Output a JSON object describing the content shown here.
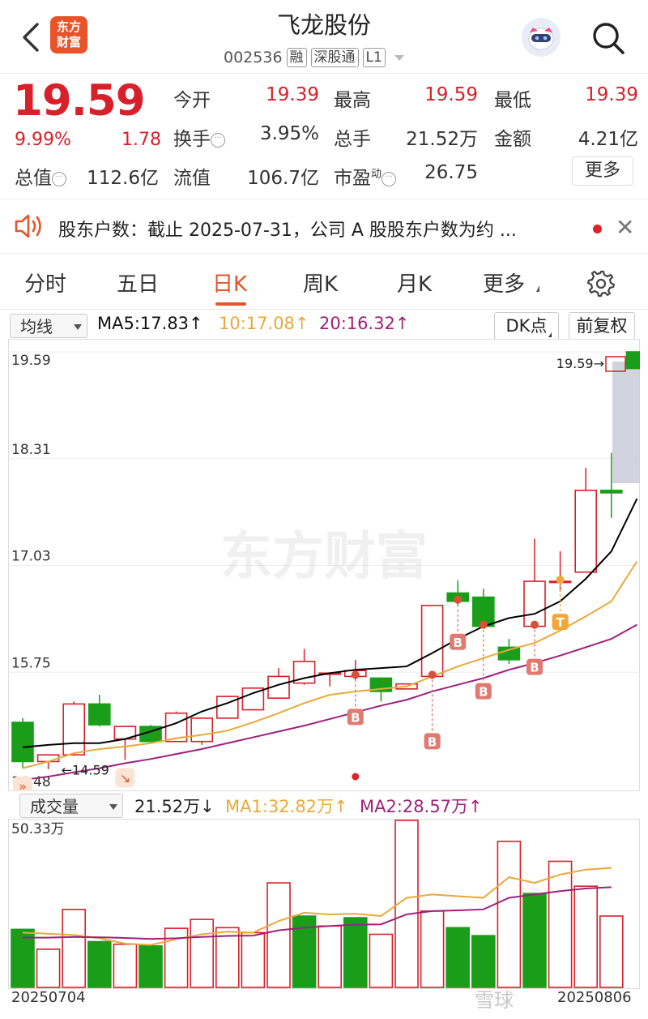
{
  "header": {
    "logo_text_line1": "东方",
    "logo_text_line2": "财富",
    "title": "飞龙股份",
    "code": "002536",
    "tags": [
      "融",
      "深股通",
      "L1"
    ]
  },
  "quote": {
    "price": "19.59",
    "change_pct": "9.99%",
    "change": "1.78",
    "fields": {
      "open_label": "今开",
      "open_value": "19.39",
      "high_label": "最高",
      "high_value": "19.59",
      "low_label": "最低",
      "low_value": "19.39",
      "turnover_label": "换手",
      "turnover_value": "3.95%",
      "volume_label": "总手",
      "volume_value": "21.52万",
      "amount_label": "金额",
      "amount_value": "4.21亿",
      "mktcap_label": "总值",
      "mktcap_value": "112.6亿",
      "float_label": "流值",
      "float_value": "106.7亿",
      "pe_label": "市盈",
      "pe_sup": "动",
      "pe_value": "26.75"
    },
    "more_label": "更多"
  },
  "notice": {
    "text": "股东户数：截止 2025-07-31，公司 A 股股东户数为约 ..."
  },
  "tabs": [
    "分时",
    "五日",
    "日K",
    "周K",
    "月K",
    "更多"
  ],
  "active_tab": "日K",
  "ma_bar": {
    "select_label": "均线",
    "ma5": "MA5:17.83↑",
    "ma10": "10:17.08↑",
    "ma20": "20:16.32↑",
    "dk_label": "DK点",
    "adjust_label": "前复权"
  },
  "kline": {
    "y_labels": [
      "19.59",
      "18.31",
      "17.03",
      "15.75",
      "14.48"
    ],
    "high_marker": "19.59→",
    "low_marker": "←14.59",
    "watermark": "东方财富"
  },
  "volume_bar": {
    "select_label": "成交量",
    "value": "21.52万↓",
    "ma1": "MA1:32.82万↑",
    "ma2": "MA2:28.57万↑",
    "y_max_label": "50.33万"
  },
  "footer": {
    "date_start": "20250704",
    "date_end": "20250806",
    "watermark": "雪球"
  },
  "colors": {
    "up": "#d8202a",
    "down": "#1a9e1a",
    "ma5": "#000000",
    "ma10": "#e8a93a",
    "ma20": "#a0207a",
    "accent": "#e8532a"
  },
  "chart_data": {
    "type": "candlestick",
    "y_range": [
      14.48,
      19.59
    ],
    "candles": [
      {
        "o": 15.15,
        "h": 15.2,
        "c": 14.68,
        "l": 14.6
      },
      {
        "o": 14.68,
        "h": 14.76,
        "c": 14.76,
        "l": 14.59
      },
      {
        "o": 14.76,
        "h": 15.4,
        "c": 15.37,
        "l": 14.76
      },
      {
        "o": 15.37,
        "h": 15.48,
        "c": 15.12,
        "l": 15.1
      },
      {
        "o": 14.95,
        "h": 15.1,
        "c": 15.1,
        "l": 14.7
      },
      {
        "o": 15.1,
        "h": 15.12,
        "c": 14.92,
        "l": 14.92
      },
      {
        "o": 14.92,
        "h": 15.28,
        "c": 15.26,
        "l": 14.92
      },
      {
        "o": 14.92,
        "h": 15.2,
        "c": 15.2,
        "l": 14.88
      },
      {
        "o": 15.2,
        "h": 15.47,
        "c": 15.46,
        "l": 15.2
      },
      {
        "o": 15.3,
        "h": 15.57,
        "c": 15.56,
        "l": 15.3
      },
      {
        "o": 15.44,
        "h": 15.8,
        "c": 15.7,
        "l": 15.44
      },
      {
        "o": 15.62,
        "h": 16.03,
        "c": 15.88,
        "l": 15.6
      },
      {
        "o": 15.74,
        "h": 15.75,
        "c": 15.74,
        "l": 15.58
      },
      {
        "o": 15.7,
        "h": 15.9,
        "c": 15.77,
        "l": 15.66
      },
      {
        "o": 15.68,
        "h": 15.69,
        "c": 15.52,
        "l": 15.4
      },
      {
        "o": 15.55,
        "h": 15.61,
        "c": 15.61,
        "l": 15.55
      },
      {
        "o": 15.7,
        "h": 16.55,
        "c": 16.55,
        "l": 15.7
      },
      {
        "o": 16.7,
        "h": 16.85,
        "c": 16.6,
        "l": 16.55
      },
      {
        "o": 16.65,
        "h": 16.75,
        "c": 16.3,
        "l": 16.3
      },
      {
        "o": 16.05,
        "h": 16.15,
        "c": 15.9,
        "l": 15.85
      },
      {
        "o": 16.3,
        "h": 17.35,
        "c": 16.84,
        "l": 16.3
      },
      {
        "o": 16.84,
        "h": 17.2,
        "c": 16.84,
        "l": 16.72
      },
      {
        "o": 16.95,
        "h": 18.2,
        "c": 17.93,
        "l": 16.95
      },
      {
        "o": 17.93,
        "h": 18.38,
        "c": 17.9,
        "l": 17.6
      },
      {
        "o": 19.59,
        "h": 19.59,
        "c": 19.39,
        "l": 19.39
      }
    ],
    "ma5": [
      14.85,
      14.88,
      14.9,
      14.9,
      14.95,
      15.04,
      15.14,
      15.28,
      15.38,
      15.5,
      15.6,
      15.68,
      15.74,
      15.78,
      15.8,
      15.82,
      15.98,
      16.15,
      16.3,
      16.4,
      16.45,
      16.6,
      16.87,
      17.2,
      17.83
    ],
    "ma10": [
      14.6,
      14.68,
      14.78,
      14.83,
      14.86,
      14.9,
      14.96,
      15.0,
      15.05,
      15.15,
      15.26,
      15.38,
      15.48,
      15.52,
      15.55,
      15.58,
      15.7,
      15.82,
      15.92,
      16.02,
      16.1,
      16.25,
      16.42,
      16.6,
      17.08
    ],
    "ma20": [
      14.46,
      14.5,
      14.55,
      14.6,
      14.66,
      14.71,
      14.77,
      14.83,
      14.9,
      14.97,
      15.04,
      15.11,
      15.19,
      15.27,
      15.35,
      15.42,
      15.52,
      15.6,
      15.68,
      15.78,
      15.86,
      15.95,
      16.05,
      16.15,
      16.32
    ],
    "signals": [
      {
        "index": 0,
        "label": "»"
      },
      {
        "index": 4,
        "label": "↘"
      },
      {
        "index": 13,
        "label": "B"
      },
      {
        "index": 16,
        "label": "B"
      },
      {
        "index": 17,
        "label": "B"
      },
      {
        "index": 18,
        "label": "B"
      },
      {
        "index": 20,
        "label": "B"
      },
      {
        "index": 21,
        "label": "T"
      }
    ],
    "volume": {
      "unit": "万",
      "y_max": 50.33,
      "bars": [
        17.5,
        11.5,
        23.5,
        13.8,
        13.0,
        12.5,
        17.8,
        20.5,
        18.0,
        16.5,
        31.5,
        21.5,
        18.5,
        21.0,
        16.0,
        51.0,
        23.0,
        18.0,
        15.6,
        44.0,
        28.3,
        38.0,
        30.5,
        21.5
      ],
      "colors": [
        "down",
        "up",
        "up",
        "down",
        "up",
        "down",
        "up",
        "up",
        "up",
        "up",
        "up",
        "down",
        "up",
        "down",
        "up",
        "up",
        "up",
        "down",
        "down",
        "up",
        "down",
        "up",
        "up",
        "up"
      ],
      "ma1": [
        16.5,
        16.2,
        15.8,
        14.8,
        13.2,
        12.8,
        14.5,
        16.0,
        16.8,
        16.5,
        20.0,
        22.5,
        22.0,
        22.2,
        21.5,
        27.0,
        28.0,
        27.5,
        27.0,
        33.2,
        31.5,
        34.0,
        35.5,
        36.0
      ],
      "ma2": [
        15.0,
        15.0,
        15.2,
        15.1,
        14.9,
        14.6,
        14.8,
        15.2,
        15.5,
        15.6,
        17.2,
        18.0,
        18.5,
        18.9,
        19.0,
        22.0,
        23.0,
        23.2,
        23.5,
        27.0,
        28.0,
        29.0,
        29.8,
        30.2
      ]
    }
  }
}
